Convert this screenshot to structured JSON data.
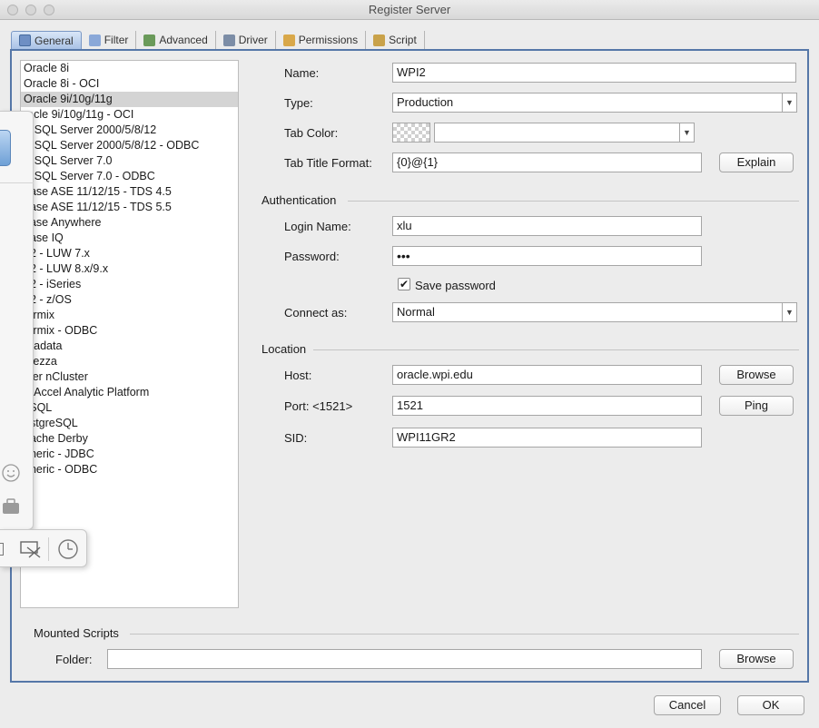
{
  "window": {
    "title": "Register Server"
  },
  "tabs": [
    {
      "label": "General",
      "icon": "general-icon"
    },
    {
      "label": "Filter",
      "icon": "filter-icon"
    },
    {
      "label": "Advanced",
      "icon": "advanced-icon"
    },
    {
      "label": "Driver",
      "icon": "driver-icon"
    },
    {
      "label": "Permissions",
      "icon": "permissions-icon"
    },
    {
      "label": "Script",
      "icon": "script-icon"
    }
  ],
  "server_types": [
    "Oracle 8i",
    "Oracle 8i - OCI",
    "Oracle 9i/10g/11g",
    "racle 9i/10g/11g - OCI",
    "S SQL Server 2000/5/8/12",
    "S SQL Server 2000/5/8/12 - ODBC",
    "S SQL Server 7.0",
    "S SQL Server 7.0 - ODBC",
    "base ASE 11/12/15 - TDS 4.5",
    "base ASE 11/12/15 - TDS 5.5",
    "base Anywhere",
    "base IQ",
    "32 - LUW 7.x",
    "32 - LUW 8.x/9.x",
    "32 - iSeries",
    "32 - z/OS",
    "formix",
    "formix - ODBC",
    "eradata",
    "etezza",
    "ster nCluster",
    "arAccel Analytic Platform",
    "ySQL",
    "ostgreSQL",
    "pache Derby",
    "eneric - JDBC",
    "eneric - ODBC"
  ],
  "selected_index": 2,
  "form": {
    "name_label": "Name:",
    "name_value": "WPI2",
    "type_label": "Type:",
    "type_value": "Production",
    "tab_color_label": "Tab Color:",
    "tab_title_label": "Tab Title Format:",
    "tab_title_value": "{0}@{1}",
    "explain_label": "Explain"
  },
  "authentication": {
    "section_label": "Authentication",
    "login_label": "Login Name:",
    "login_value": "xlu",
    "password_label": "Password:",
    "password_value": "•••",
    "save_password_label": "Save password",
    "save_password_checked": "✔",
    "connect_as_label": "Connect as:",
    "connect_as_value": "Normal"
  },
  "location": {
    "section_label": "Location",
    "host_label": "Host:",
    "host_value": "oracle.wpi.edu",
    "browse_label": "Browse",
    "port_label": "Port: <1521>",
    "port_value": "1521",
    "ping_label": "Ping",
    "sid_label": "SID:",
    "sid_value": "WPI11GR2"
  },
  "mounted": {
    "section_label": "Mounted Scripts",
    "folder_label": "Folder:",
    "folder_value": "",
    "browse_label": "Browse"
  },
  "footer": {
    "cancel_label": "Cancel",
    "ok_label": "OK"
  },
  "colors": {
    "accent": "#5577a8",
    "selected_row": "#d4d4d4"
  }
}
